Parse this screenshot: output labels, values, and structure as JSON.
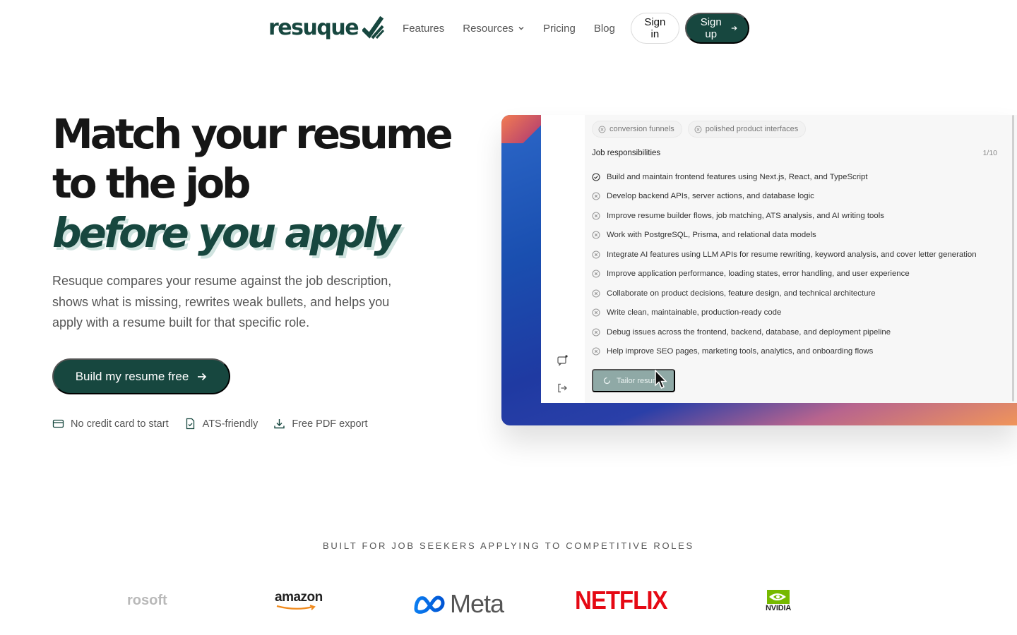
{
  "nav": {
    "logo_text": "resuque",
    "links": [
      {
        "label": "Features"
      },
      {
        "label": "Resources"
      },
      {
        "label": "Pricing"
      },
      {
        "label": "Blog"
      }
    ],
    "signin_label": "Sign in",
    "signup_label": "Sign up"
  },
  "hero": {
    "title_line1": "Match your resume",
    "title_line2": "to the job",
    "title_accent": "before you apply",
    "description": "Resuque compares your resume against the job description, shows what is missing, rewrites weak bullets, and helps you apply with a resume built for that specific role.",
    "cta_label": "Build my resume free",
    "perks": [
      {
        "label": "No credit card to start",
        "icon": "credit-card-icon"
      },
      {
        "label": "ATS-friendly",
        "icon": "file-check-icon"
      },
      {
        "label": "Free PDF export",
        "icon": "download-icon"
      }
    ]
  },
  "preview": {
    "chips": [
      {
        "label": "conversion funnels"
      },
      {
        "label": "polished product interfaces"
      }
    ],
    "section_title": "Job responsibilities",
    "section_count": "1/10",
    "responsibilities": [
      {
        "text": "Build and maintain frontend features using Next.js, React, and TypeScript",
        "checked": true
      },
      {
        "text": "Develop backend APIs, server actions, and database logic",
        "checked": false
      },
      {
        "text": "Improve resume builder flows, job matching, ATS analysis, and AI writing tools",
        "checked": false
      },
      {
        "text": "Work with PostgreSQL, Prisma, and relational data models",
        "checked": false
      },
      {
        "text": "Integrate AI features using LLM APIs for resume rewriting, keyword analysis, and cover letter generation",
        "checked": false
      },
      {
        "text": "Improve application performance, loading states, error handling, and user experience",
        "checked": false
      },
      {
        "text": "Collaborate on product decisions, feature design, and technical architecture",
        "checked": false
      },
      {
        "text": "Write clean, maintainable, production-ready code",
        "checked": false
      },
      {
        "text": "Debug issues across the frontend, backend, database, and deployment pipeline",
        "checked": false
      },
      {
        "text": "Help improve SEO pages, marketing tools, analytics, and onboarding flows",
        "checked": false
      }
    ],
    "tailor_label": "Tailor resume"
  },
  "logos": {
    "heading": "BUILT FOR JOB SEEKERS APPLYING TO COMPETITIVE ROLES",
    "brands": [
      {
        "label": "rosoft"
      },
      {
        "label": "amazon"
      },
      {
        "label": "Meta"
      },
      {
        "label": "NETFLIX"
      },
      {
        "label": "NVIDIA"
      }
    ]
  },
  "colors": {
    "brand": "#17473f",
    "netflix": "#e50914"
  }
}
